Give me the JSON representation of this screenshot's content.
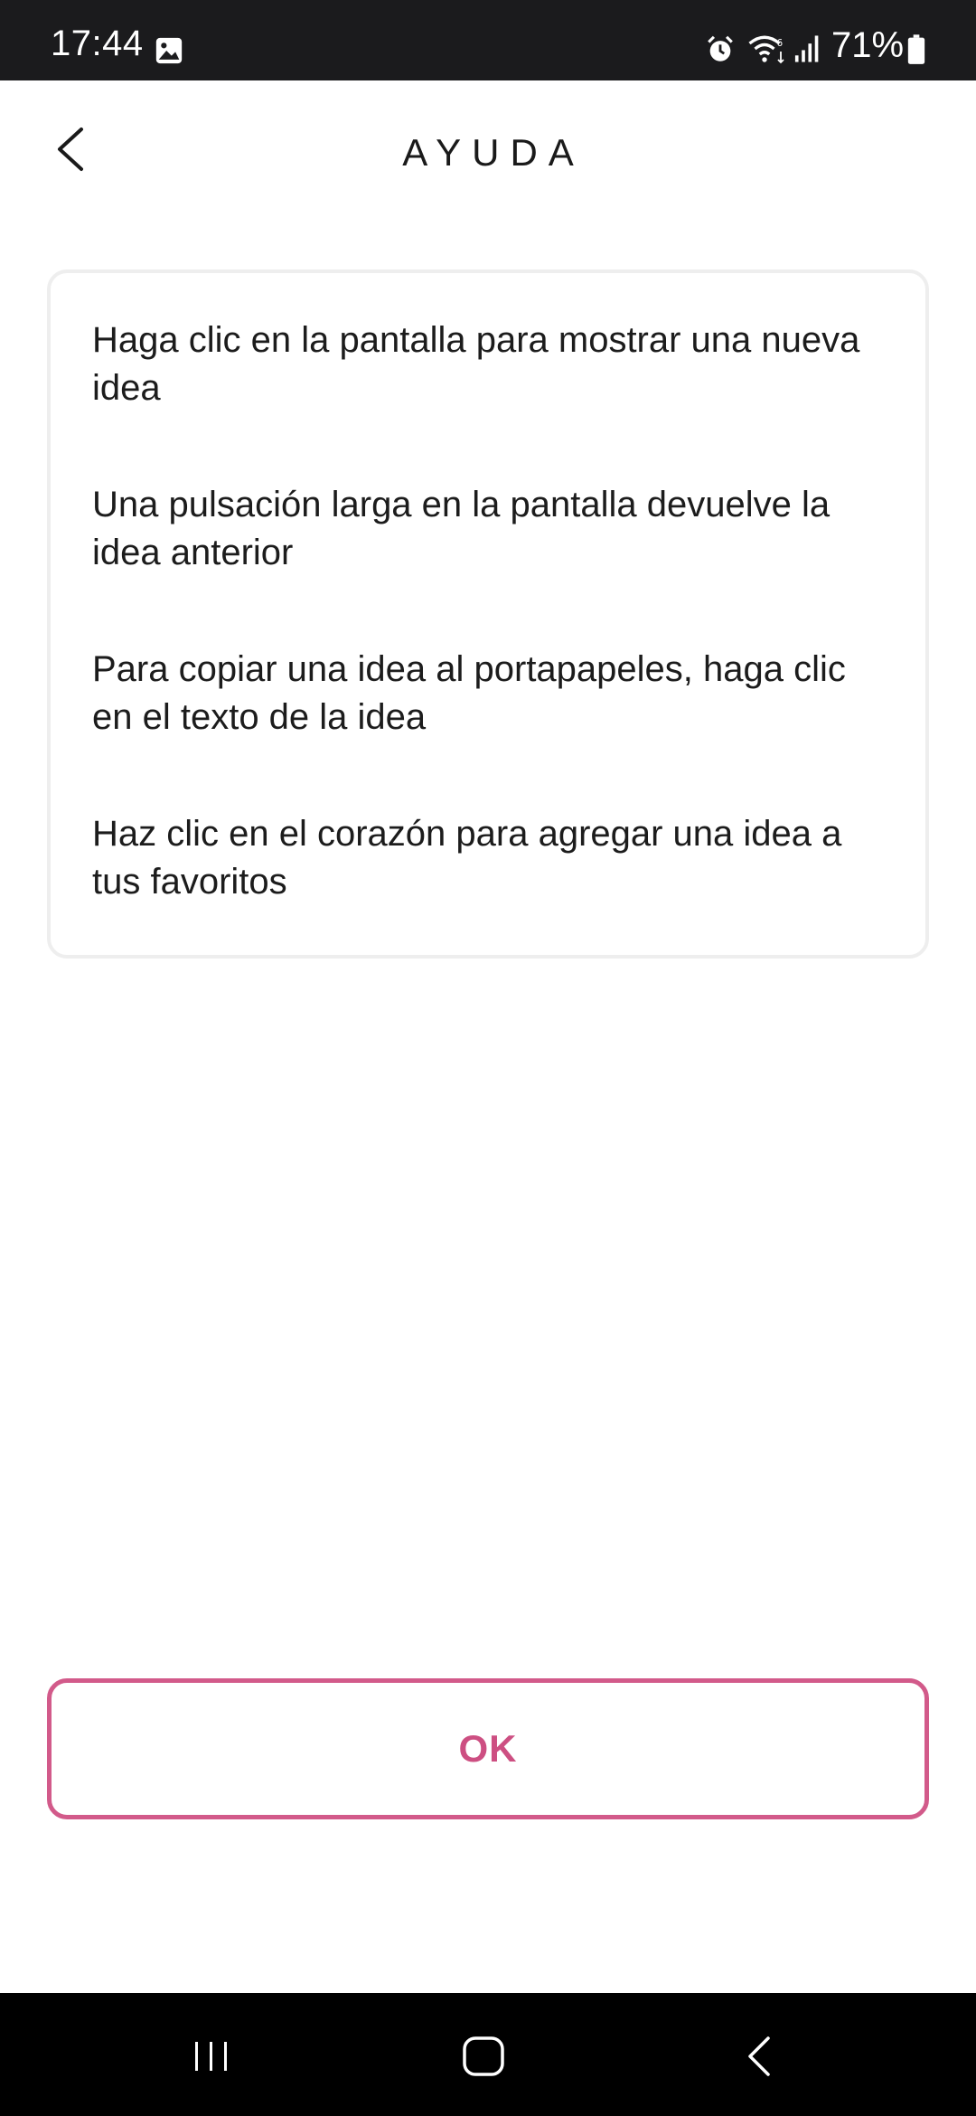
{
  "status_bar": {
    "time": "17:44",
    "battery_text": "71%",
    "icons": [
      "gallery-icon",
      "alarm-icon",
      "wifi-icon",
      "signal-icon",
      "battery-icon"
    ]
  },
  "header": {
    "title": "AYUDA",
    "back_icon": "chevron-left-icon"
  },
  "help": {
    "items": [
      {
        "text": "Haga clic en la pantalla para mostrar una nueva idea"
      },
      {
        "text": "Una pulsación larga en la pantalla devuelve la idea anterior"
      },
      {
        "text": "Para copiar una idea al portapapeles, haga clic en el texto de la idea"
      },
      {
        "text": "Haz clic en el corazón para agregar una idea a tus favoritos"
      }
    ]
  },
  "actions": {
    "ok_label": "OK"
  },
  "nav_bar": {
    "icons": [
      "recents-icon",
      "home-icon",
      "back-icon"
    ]
  },
  "colors": {
    "accent": "#cd4f82",
    "accent_border": "#d25a8a",
    "status_bar_bg": "#1b1b1d",
    "nav_bar_bg": "#000000",
    "card_border": "#eeeeee",
    "text": "#1c1c1c"
  }
}
